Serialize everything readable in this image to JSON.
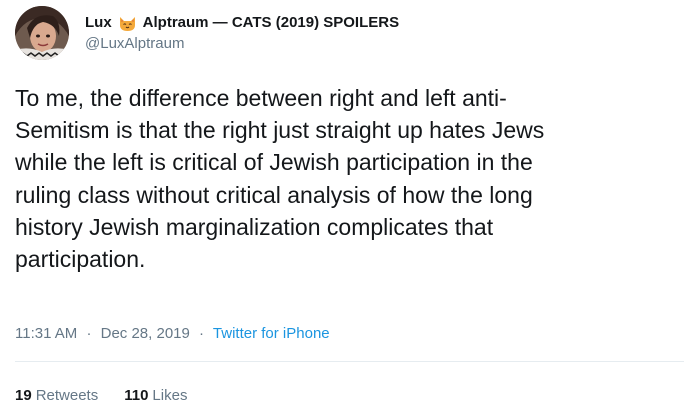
{
  "author": {
    "name_first": "Lux",
    "name_rest": "Alptraum — CATS (2019) SPOILERS",
    "handle": "@LuxAlptraum",
    "name_emoji_icon": "cat-face-icon"
  },
  "tweet": {
    "lines": [
      "To me, the difference between right and left anti-",
      "Semitism is that the right just straight up hates Jews",
      "while the left is critical of Jewish participation in the",
      "ruling class without critical analysis of how the long",
      "history Jewish marginalization complicates that",
      "participation."
    ],
    "time": "11:31 AM",
    "separator": "·",
    "date": "Dec 28, 2019",
    "source": "Twitter for iPhone"
  },
  "stats": {
    "retweets_count": "19",
    "retweets_label": "Retweets",
    "likes_count": "110",
    "likes_label": "Likes"
  },
  "colors": {
    "text": "#14171a",
    "secondary": "#657786",
    "link": "#1b95e0",
    "divider": "#e6ecf0"
  }
}
